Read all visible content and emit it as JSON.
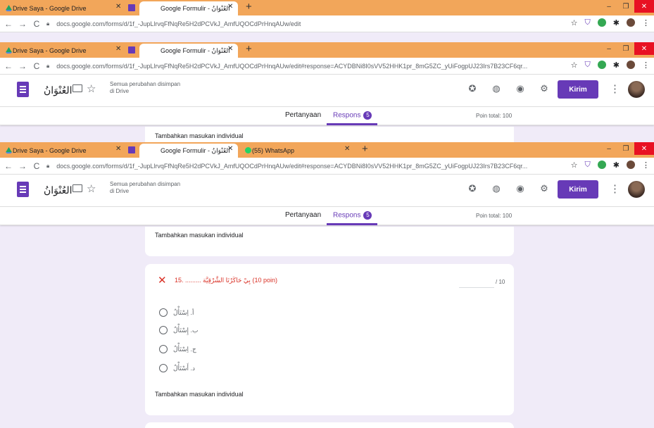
{
  "browser": {
    "tab_drive": "Drive Saya - Google Drive",
    "tab_forms": "Google Formulir - العُنْوَانُ",
    "tab_whatsapp": "(55) WhatsApp",
    "url_first": "docs.google.com/forms/d/1f_-JupLlrvqFfNqRe5H2dPCVkJ_AmfUQOCdPrHnqAUw/edit",
    "url_second": "docs.google.com/forms/d/1f_-JupLlrvqFfNqRe5H2dPCVkJ_AmfUQOCdPrHnqAUw/edit#response=ACYDBNi8I0sVV52HHK1pr_8mG5ZC_yUiFogpUJ23Irs7B23CF6qr...",
    "url_third": "docs.google.com/forms/d/1f_-JupLlrvqFfNqRe5H2dPCVkJ_AmfUQOCdPrHnqAUw/edit#response=ACYDBNi8I0sVV52HHK1pr_8mG5ZC_yUiFogpUJ23Irs7B23CF6qr..."
  },
  "form_header": {
    "title": "العُنْوَانُ",
    "saved_line1": "Semua perubahan disimpan",
    "saved_line2": "di Drive",
    "send_label": "Kirim"
  },
  "form_tabs": {
    "questions": "Pertanyaan",
    "responses": "Respons",
    "responses_count": "5",
    "total_points": "Poin total: 100"
  },
  "cards": {
    "add_individual_top": "Tambahkan masukan individual",
    "question_title": "15. ......... بِيْ حَاكَرْتَا الشَّرْقِيَّة (10 poin)",
    "score_max": "/ 10",
    "options": [
      "أ. اِسْتَأْلٌ",
      "ب. إِسْتَأْلٌ",
      "ج. اِسْتَأْلٌ",
      "د. أَسْتَأْلٌ"
    ],
    "add_individual_bottom": "Tambahkan masukan individual"
  },
  "colors": {
    "accent": "#673ab7",
    "tabbar": "#f2a65a",
    "background": "#f0ebf8",
    "error": "#d93025"
  }
}
